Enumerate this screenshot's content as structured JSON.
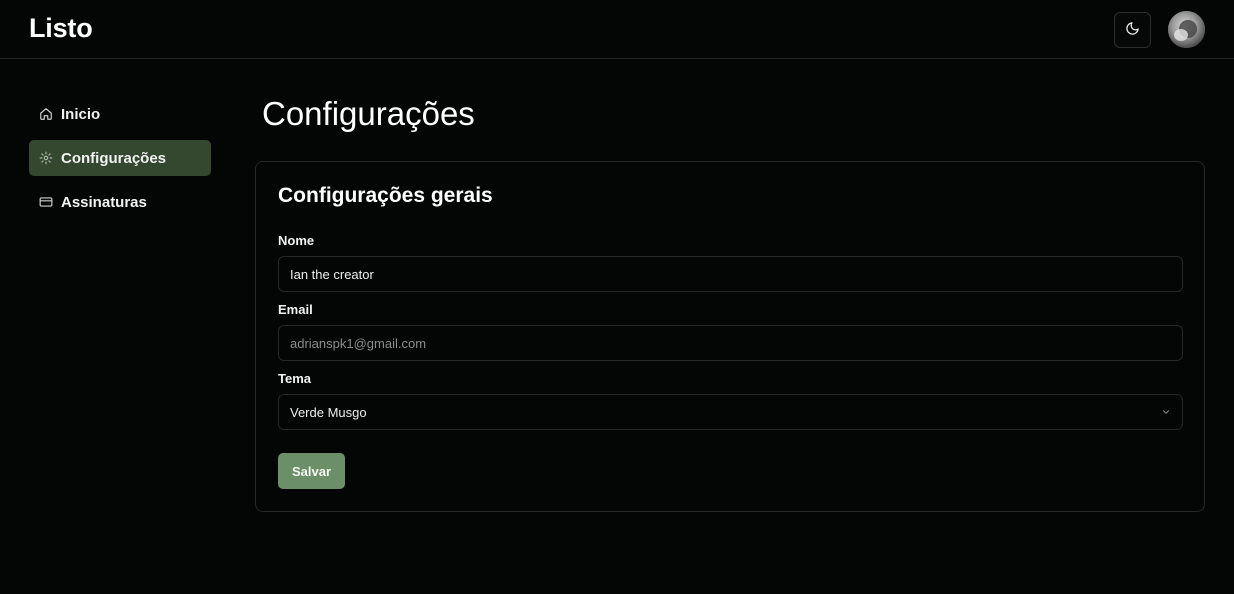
{
  "header": {
    "logo": "Listo"
  },
  "sidebar": {
    "items": [
      {
        "label": "Inicio",
        "icon": "home-icon",
        "active": false
      },
      {
        "label": "Configurações",
        "icon": "gear-icon",
        "active": true
      },
      {
        "label": "Assinaturas",
        "icon": "credit-card-icon",
        "active": false
      }
    ]
  },
  "main": {
    "title": "Configurações",
    "card": {
      "title": "Configurações gerais",
      "name_label": "Nome",
      "name_value": "Ian the creator",
      "email_label": "Email",
      "email_value": "adrianspk1@gmail.com",
      "theme_label": "Tema",
      "theme_value": "Verde Musgo",
      "save_label": "Salvar"
    }
  },
  "colors": {
    "background": "#030604",
    "active_nav": "#34472f",
    "button": "#6b8f66"
  }
}
